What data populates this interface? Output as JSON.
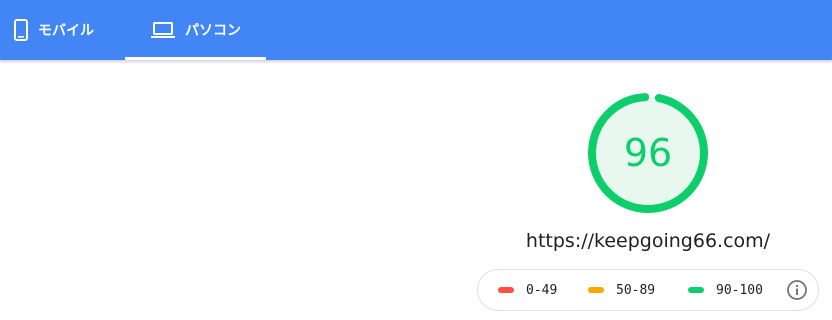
{
  "tabs": {
    "mobile": {
      "label": "モバイル",
      "icon": "smartphone-icon"
    },
    "desktop": {
      "label": "パソコン",
      "icon": "laptop-icon",
      "selected": true
    }
  },
  "score": {
    "value": "96",
    "fraction": 0.96,
    "color": "#0cce6b",
    "track_fill": "#e8f8ef"
  },
  "url": "https://keepgoing66.com/",
  "legend": {
    "fail": {
      "label": "0-49",
      "color": "#ff4e42"
    },
    "average": {
      "label": "50-89",
      "color": "#ffa400"
    },
    "pass": {
      "label": "90-100",
      "color": "#0cce6b"
    },
    "info_icon": "info-icon"
  },
  "colors": {
    "header": "#4285f4"
  }
}
